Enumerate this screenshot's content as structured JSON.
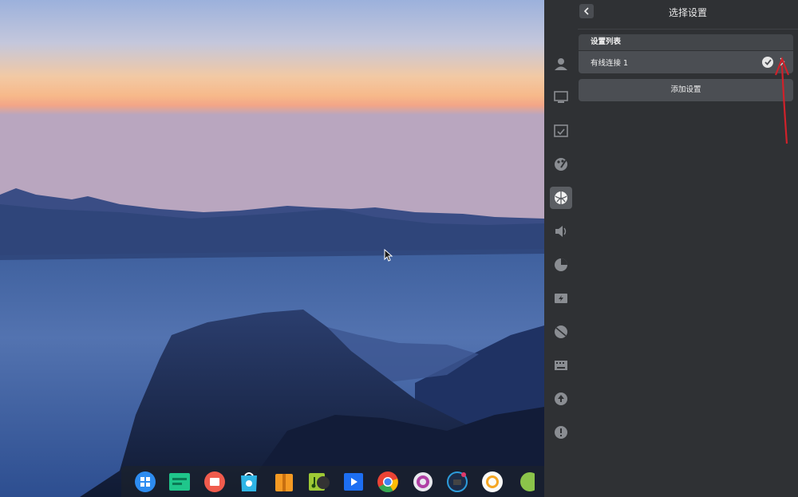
{
  "panel": {
    "title": "选择设置",
    "settings_list_header": "设置列表",
    "connection_name": "有线连接 1",
    "add_button_label": "添加设置"
  },
  "nav_icons": [
    "account-icon",
    "display-icon",
    "default-apps-icon",
    "personalization-icon",
    "network-icon",
    "sound-icon",
    "time-icon",
    "power-icon",
    "mouse-icon",
    "keyboard-icon",
    "update-icon",
    "info-icon"
  ],
  "dock_apps": [
    "launcher-icon",
    "file-manager-icon",
    "app-store-icon",
    "screenshot-icon",
    "archive-icon",
    "music-icon",
    "video-icon",
    "chrome-icon",
    "settings-icon",
    "browser-icon",
    "camera-icon",
    "partial-app-icon"
  ],
  "colors": {
    "panel_bg": "#2f3134",
    "row_bg": "#4b4e53",
    "accent_red": "#d0212a"
  }
}
